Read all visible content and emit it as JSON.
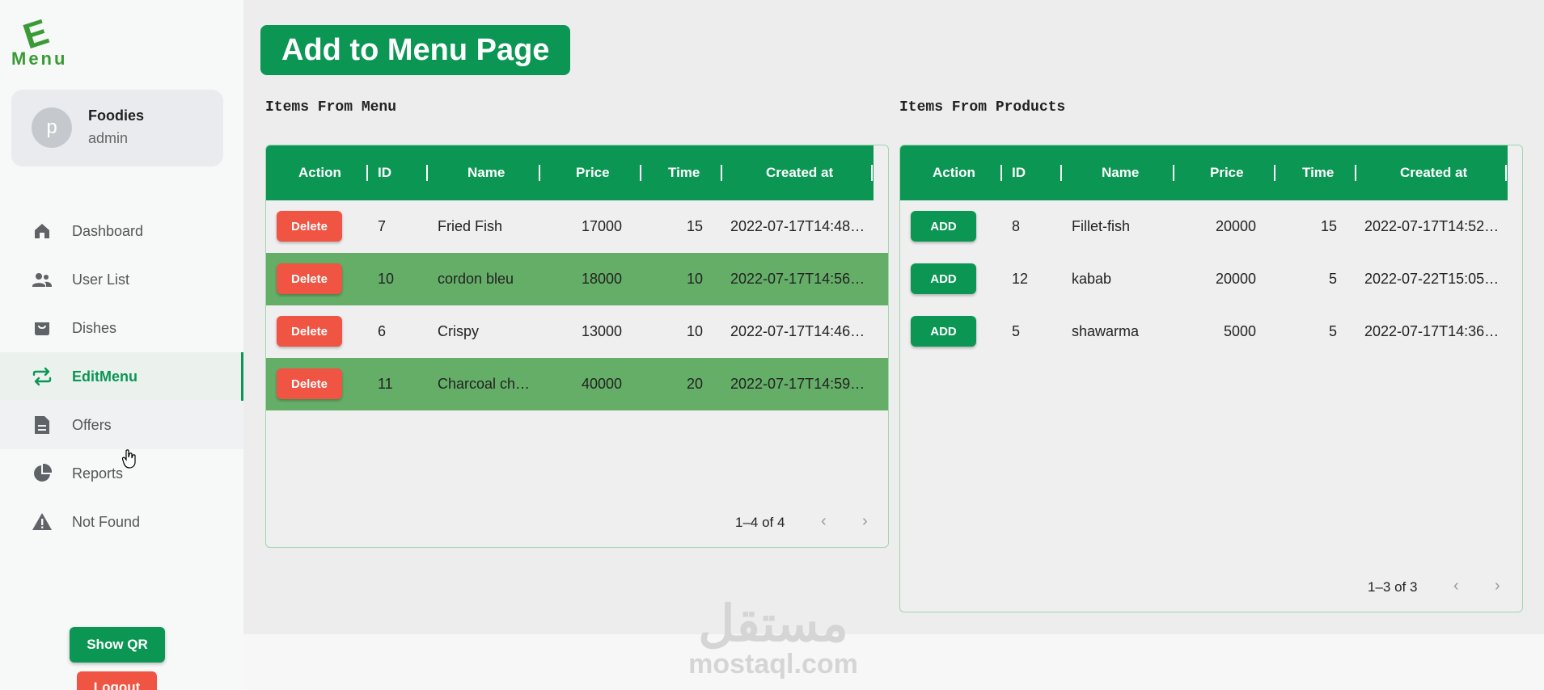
{
  "brand": {
    "logo_letter": "E",
    "logo_word": "Menu"
  },
  "profile": {
    "avatar_initial": "p",
    "name": "Foodies",
    "role": "admin"
  },
  "nav": {
    "items": [
      {
        "label": "Dashboard",
        "icon": "home-icon"
      },
      {
        "label": "User List",
        "icon": "users-icon"
      },
      {
        "label": "Dishes",
        "icon": "bag-icon"
      },
      {
        "label": "EditMenu",
        "icon": "swap-icon",
        "active": true
      },
      {
        "label": "Offers",
        "icon": "document-icon"
      },
      {
        "label": "Reports",
        "icon": "pie-chart-icon"
      },
      {
        "label": "Not Found",
        "icon": "warning-icon"
      }
    ]
  },
  "buttons": {
    "show_qr": "Show QR",
    "logout": "Logout"
  },
  "page": {
    "title": "Add to Menu Page"
  },
  "menu_table": {
    "title": "Items From Menu",
    "columns": [
      "Action",
      "ID",
      "Name",
      "Price",
      "Time",
      "Created at"
    ],
    "action_label": "Delete",
    "rows": [
      {
        "id": "7",
        "name": "Fried Fish",
        "price": "17000",
        "time": "15",
        "created": "2022-07-17T14:48…"
      },
      {
        "id": "10",
        "name": "cordon bleu",
        "price": "18000",
        "time": "10",
        "created": "2022-07-17T14:56…"
      },
      {
        "id": "6",
        "name": "Crispy",
        "price": "13000",
        "time": "10",
        "created": "2022-07-17T14:46…"
      },
      {
        "id": "11",
        "name": "Charcoal ch…",
        "price": "40000",
        "time": "20",
        "created": "2022-07-17T14:59…"
      }
    ],
    "pagination": "1–4 of 4"
  },
  "products_table": {
    "title": "Items From Products",
    "columns": [
      "Action",
      "ID",
      "Name",
      "Price",
      "Time",
      "Created at"
    ],
    "action_label": "ADD",
    "rows": [
      {
        "id": "8",
        "name": "Fillet-fish",
        "price": "20000",
        "time": "15",
        "created": "2022-07-17T14:52…"
      },
      {
        "id": "12",
        "name": "kabab",
        "price": "20000",
        "time": "5",
        "created": "2022-07-22T15:05…"
      },
      {
        "id": "5",
        "name": "shawarma",
        "price": "5000",
        "time": "5",
        "created": "2022-07-17T14:36…"
      }
    ],
    "pagination": "1–3 of 3"
  },
  "watermark": {
    "arabic": "مستقل",
    "latin": "mostaql.com"
  },
  "colors": {
    "primary": "#0b9654",
    "danger": "#f05443",
    "row_highlight": "#65ae68"
  }
}
